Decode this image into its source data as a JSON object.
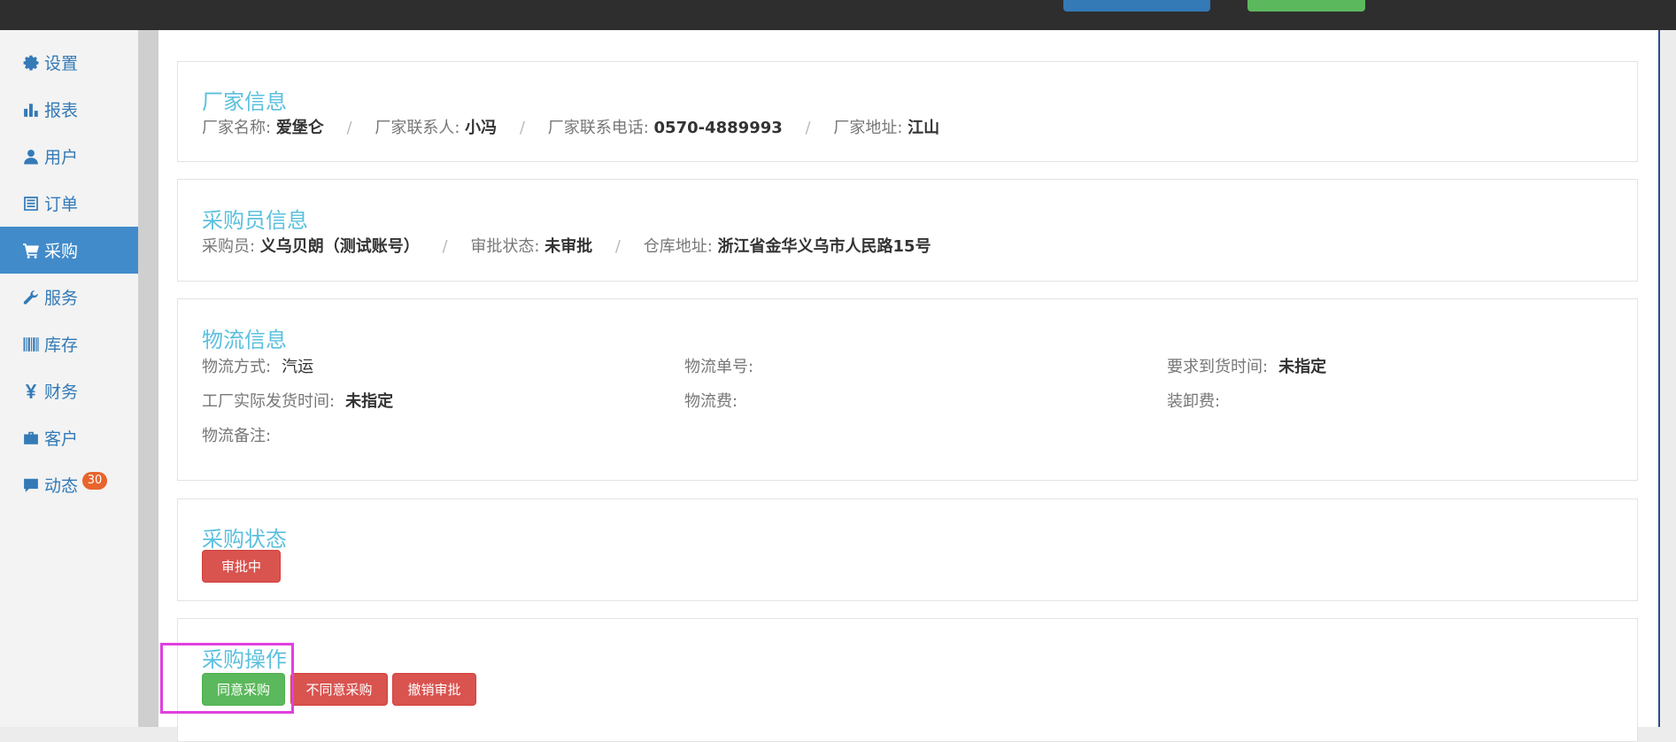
{
  "colors": {
    "accent": "#428bca",
    "title": "#5bc0de",
    "danger": "#d9534f",
    "success": "#5cb85c",
    "badge": "#e8642c",
    "highlight": "#e040e0"
  },
  "sidebar": {
    "items": [
      {
        "label": "设置",
        "icon": "gear-icon"
      },
      {
        "label": "报表",
        "icon": "bar-chart-icon"
      },
      {
        "label": "用户",
        "icon": "user-icon"
      },
      {
        "label": "订单",
        "icon": "list-icon"
      },
      {
        "label": "采购",
        "icon": "cart-icon",
        "active": true
      },
      {
        "label": "服务",
        "icon": "wrench-icon"
      },
      {
        "label": "库存",
        "icon": "barcode-icon"
      },
      {
        "label": "财务",
        "icon": "yen-icon"
      },
      {
        "label": "客户",
        "icon": "briefcase-icon"
      },
      {
        "label": "动态",
        "icon": "comment-icon",
        "badge": "30"
      }
    ]
  },
  "factory": {
    "title": "厂家信息",
    "name_label": "厂家名称:",
    "name": "爱堡仑",
    "contact_label": "厂家联系人:",
    "contact": "小冯",
    "phone_label": "厂家联系电话:",
    "phone": "0570-4889993",
    "address_label": "厂家地址:",
    "address": "江山",
    "separator": "/"
  },
  "buyer": {
    "title": "采购员信息",
    "buyer_label": "采购员:",
    "buyer": "义乌贝朗（测试账号）",
    "status_label": "审批状态:",
    "status": "未审批",
    "warehouse_label": "仓库地址:",
    "warehouse": "浙江省金华义乌市人民路15号",
    "separator": "/"
  },
  "logistics": {
    "title": "物流信息",
    "method_label": "物流方式:",
    "method": "汽运",
    "tracking_label": "物流单号:",
    "tracking": "",
    "arrival_label": "要求到货时间:",
    "arrival": "未指定",
    "ship_time_label": "工厂实际发货时间:",
    "ship_time": "未指定",
    "fee_label": "物流费:",
    "fee": "",
    "handling_label": "装卸费:",
    "handling": "",
    "remark_label": "物流备注:",
    "remark": ""
  },
  "purchase_status": {
    "title": "采购状态",
    "status_button": "审批中"
  },
  "purchase_actions": {
    "title": "采购操作",
    "approve": "同意采购",
    "reject": "不同意采购",
    "revoke": "撤销审批"
  }
}
